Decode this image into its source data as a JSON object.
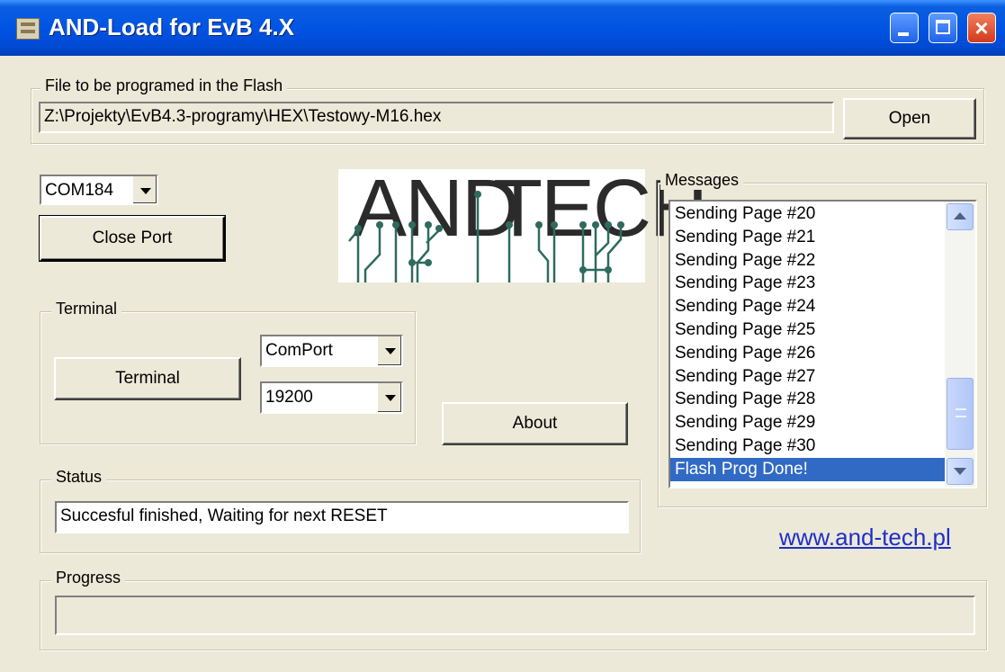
{
  "window": {
    "title": "AND-Load for EvB 4.X",
    "controls": {
      "minimize": "minimize-icon",
      "maximize": "maximize-icon",
      "close": "×"
    }
  },
  "file_group": {
    "legend": "File to be programed in the Flash",
    "path": "Z:\\Projekty\\EvB4.3-programy\\HEX\\Testowy-M16.hex",
    "open_label": "Open"
  },
  "port": {
    "selected": "COM184",
    "close_label": "Close Port"
  },
  "logo": {
    "left": "AND",
    "right": "TECH",
    "colors": {
      "text": "#2b2b2b",
      "traces": "#2e6b5e"
    }
  },
  "terminal": {
    "legend": "Terminal",
    "button_label": "Terminal",
    "source": "ComPort",
    "baud": "19200"
  },
  "about_label": "About",
  "messages": {
    "legend": "Messages",
    "items": [
      "Sending Page #20",
      "Sending Page #21",
      "Sending Page #22",
      "Sending Page #23",
      "Sending Page #24",
      "Sending Page #25",
      "Sending Page #26",
      "Sending Page #27",
      "Sending Page #28",
      "Sending Page #29",
      "Sending Page #30",
      "Flash Prog Done!"
    ],
    "selected_index": 11
  },
  "status": {
    "legend": "Status",
    "text": "Succesful finished, Waiting for next RESET"
  },
  "website": "www.and-tech.pl",
  "progress": {
    "legend": "Progress",
    "fraction": 0
  },
  "colors": {
    "titlebar": "#0054e3",
    "face": "#ece9d8",
    "selection": "#316ac5",
    "link": "#1f2ec8"
  }
}
